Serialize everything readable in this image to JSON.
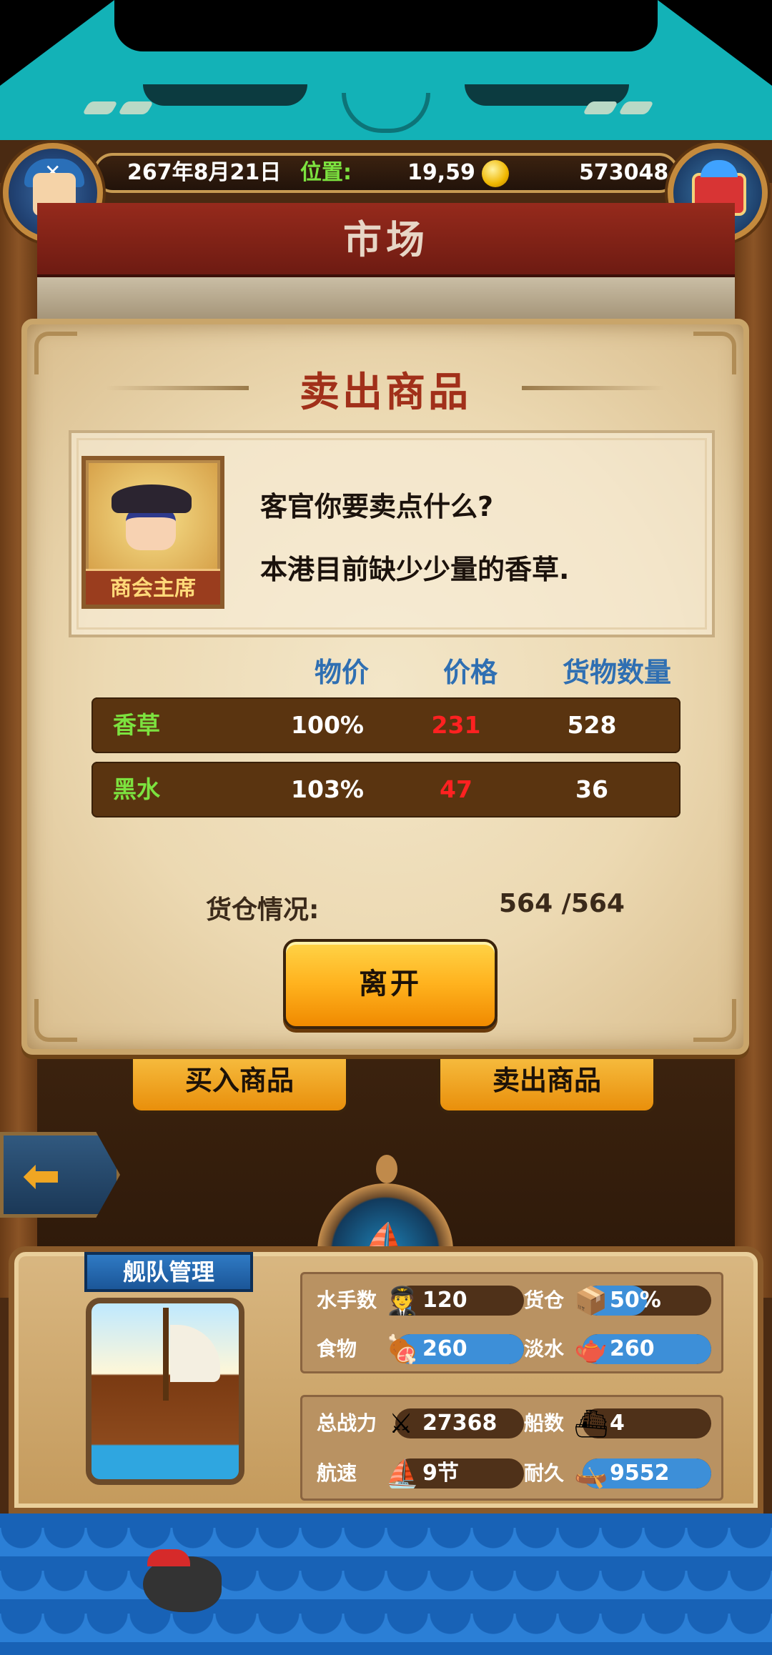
{
  "header": {
    "date": "267年8月21日",
    "position_label": "位置:",
    "position_value": "19,59",
    "gold": "573048"
  },
  "market": {
    "title": "市场"
  },
  "dialog": {
    "title": "卖出商品",
    "npc_name": "商会主席",
    "line1": "客官你要卖点什么?",
    "line2": "本港目前缺少少量的香草."
  },
  "table": {
    "headers": {
      "index": "物价",
      "price": "价格",
      "qty": "货物数量"
    },
    "rows": [
      {
        "name": "香草",
        "index": "100%",
        "price": "231",
        "qty": "528"
      },
      {
        "name": "黑水",
        "index": "103%",
        "price": "47",
        "qty": "36"
      }
    ]
  },
  "cargo": {
    "label": "货仓情况:",
    "value": "564 /564"
  },
  "buttons": {
    "leave": "离开",
    "buy_tab": "买入商品",
    "sell_tab": "卖出商品"
  },
  "fleet": {
    "label": "舰队管理",
    "sailors_label": "水手数",
    "sailors": "120",
    "sailors_fill": 0.12,
    "hold_label": "货仓",
    "hold": "50%",
    "hold_fill": 0.5,
    "food_label": "食物",
    "food": "260",
    "food_fill": 1.0,
    "water_label": "淡水",
    "water": "260",
    "water_fill": 1.0,
    "power_label": "总战力",
    "power": "27368",
    "ships_label": "船数",
    "ships": "4",
    "speed_label": "航速",
    "speed": "9节",
    "durability_label": "耐久",
    "durability": "9552",
    "durability_fill": 1.0
  },
  "colors": {
    "accent": "#13b2b7",
    "price_red": "#ff2121",
    "goods_green": "#7ce23f"
  },
  "icons": [
    "avatar-icon",
    "treasure-chest-icon",
    "coin-icon",
    "back-arrow-icon",
    "helm-boat-icon",
    "sailor-icon",
    "crate-icon",
    "meat-icon",
    "water-jug-icon",
    "crossed-swords-icon",
    "ship-icon",
    "sail-icon",
    "hull-icon",
    "alert-ship-icon"
  ]
}
